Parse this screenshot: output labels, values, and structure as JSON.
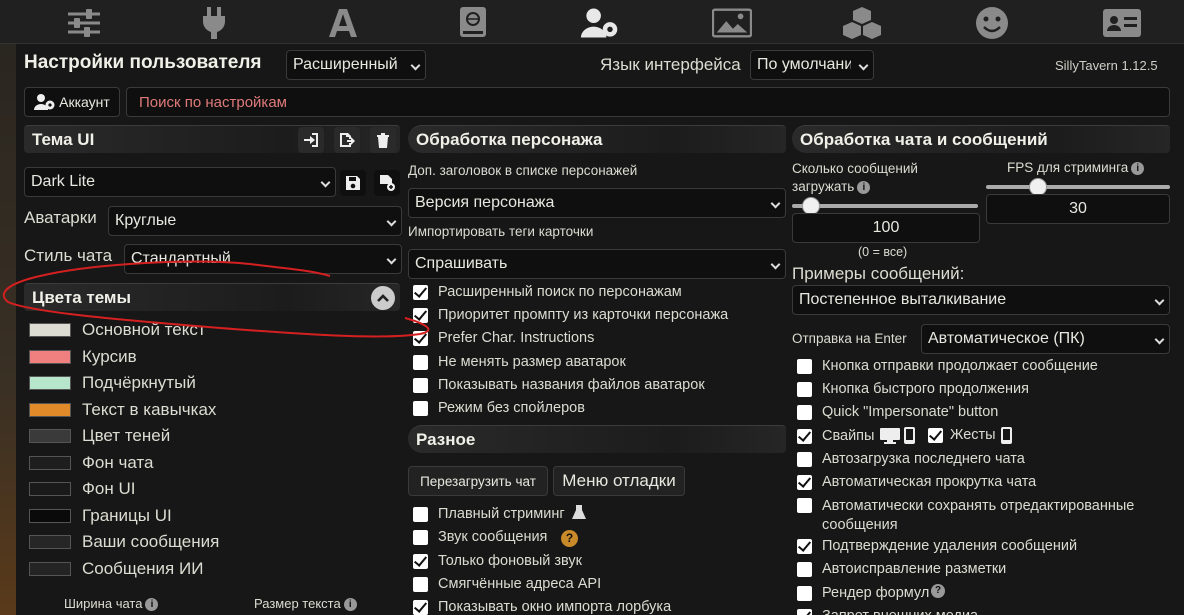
{
  "topbar": {
    "icons": [
      "sliders-icon",
      "plug-icon",
      "font-icon",
      "book-globe-icon",
      "user-gear-icon",
      "image-icon",
      "cubes-icon",
      "smiley-icon",
      "id-card-icon"
    ],
    "active": "user-gear-icon"
  },
  "header": {
    "title": "Настройки пользователя",
    "mode_select": "Расширенный",
    "lang_label": "Язык интерфейса",
    "lang_select": "По умолчанию",
    "version": "SillyTavern 1.12.5"
  },
  "account_button": "Аккаунт",
  "search": {
    "placeholder": "Поиск по настройкам"
  },
  "theme": {
    "header": "Тема UI",
    "selected": "Dark Lite",
    "avatars_label": "Аватарки",
    "avatars_value": "Круглые",
    "chat_style_label": "Стиль чата",
    "chat_style_value": "Стандартный",
    "colors_header": "Цвета темы",
    "colors": [
      {
        "label": "Основной текст",
        "color": "#dcdcd2"
      },
      {
        "label": "Курсив",
        "color": "#f08080"
      },
      {
        "label": "Подчёркнутый",
        "color": "#b8e6cc"
      },
      {
        "label": "Текст в кавычках",
        "color": "#e08a2a"
      },
      {
        "label": "Цвет теней",
        "color": "#3a3a3a"
      },
      {
        "label": "Фон чата",
        "color": "#1e1e1e"
      },
      {
        "label": "Фон UI",
        "color": "#1a1a1a"
      },
      {
        "label": "Границы UI",
        "color": "#0a0a0a"
      },
      {
        "label": "Ваши сообщения",
        "color": "#262626"
      },
      {
        "label": "Сообщения ИИ",
        "color": "#242424"
      }
    ],
    "chat_width_label": "Ширина чата",
    "text_size_label": "Размер текста"
  },
  "character": {
    "header": "Обработка персонажа",
    "extra_header_label": "Доп. заголовок в списке персонажей",
    "extra_header_value": "Версия персонажа",
    "import_tags_label": "Импортировать теги карточки",
    "import_tags_value": "Спрашивать",
    "checkboxes": [
      {
        "label": "Расширенный поиск по персонажам",
        "checked": true
      },
      {
        "label": "Приоритет промпту из карточки персонажа",
        "checked": true
      },
      {
        "label": "Prefer Char. Instructions",
        "checked": true
      },
      {
        "label": "Не менять размер аватарок",
        "checked": false
      },
      {
        "label": "Показывать названия файлов аватарок",
        "checked": false
      },
      {
        "label": "Режим без спойлеров",
        "checked": false
      }
    ]
  },
  "misc": {
    "header": "Разное",
    "reload_chat": "Перезагрузить чат",
    "debug_menu": "Меню отладки",
    "checkboxes": [
      {
        "label": "Плавный стриминг",
        "checked": false
      },
      {
        "label": "Звук сообщения",
        "checked": false
      },
      {
        "label": "Только фоновый звук",
        "checked": true
      },
      {
        "label": "Смягчённые адреса API",
        "checked": false
      },
      {
        "label": "Показывать окно импорта лорбука",
        "checked": true
      }
    ]
  },
  "chat": {
    "header": "Обработка чата и сообщений",
    "messages_to_load_label": "Сколько сообщений загружать",
    "messages_to_load_value": "100",
    "messages_to_load_slider": 0.1,
    "zero_all": "(0 = все)",
    "fps_label": "FPS для стриминга",
    "fps_value": "30",
    "fps_slider": 0.28,
    "examples_label": "Примеры сообщений:",
    "examples_value": "Постепенное выталкивание",
    "enter_label": "Отправка на Enter",
    "enter_value": "Автоматическое (ПК)",
    "checkboxes": [
      {
        "label": "Кнопка отправки продолжает сообщение",
        "checked": false
      },
      {
        "label": "Кнопка быстрого продолжения",
        "checked": false
      },
      {
        "label": "Quick \"Impersonate\" button",
        "checked": false
      },
      {
        "label": "Свайпы",
        "checked": true
      },
      {
        "label": "Автозагрузка последнего чата",
        "checked": false
      },
      {
        "label": "Автоматическая прокрутка чата",
        "checked": true
      },
      {
        "label": "Автоматически сохранять отредактированные сообщения",
        "checked": false
      },
      {
        "label": "Подтверждение удаления сообщений",
        "checked": true
      },
      {
        "label": "Автоисправление разметки",
        "checked": false
      },
      {
        "label": "Рендер формул",
        "checked": false
      },
      {
        "label": "Запрет внешних медиа",
        "checked": true
      }
    ],
    "gestures_label": "Жесты",
    "gestures_checked": true
  }
}
